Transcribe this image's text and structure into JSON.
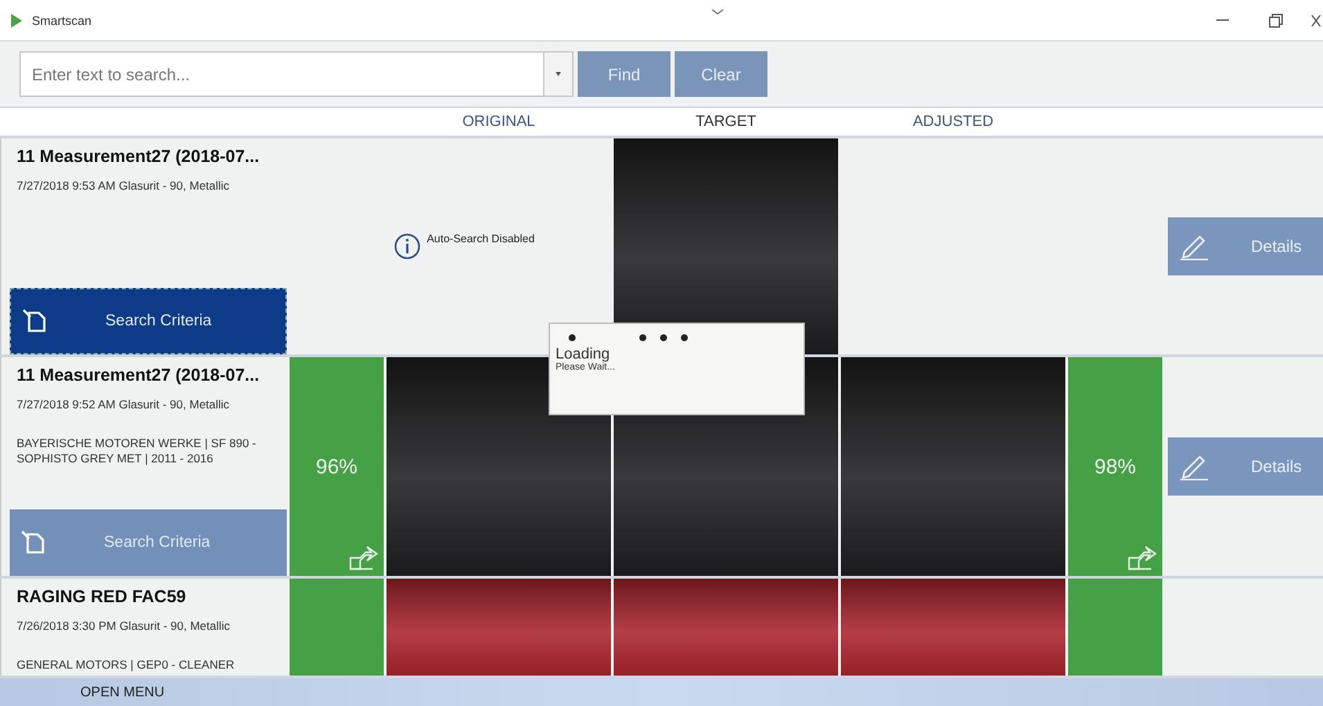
{
  "window": {
    "title": "Smartscan"
  },
  "search": {
    "placeholder": "Enter text to search...",
    "buttons": [
      "Find",
      "Clear"
    ]
  },
  "columns": [
    "ORIGINAL",
    "TARGET",
    "ADJUSTED"
  ],
  "rows": [
    {
      "kind": "unmatched",
      "title": "11 Measurement27 (2018-07...",
      "meta": "7/27/2018 9:53 AM  Glasurit - 90, Metallic",
      "color": "#1e1e20",
      "notice": "Auto-Search Disabled",
      "criteria": {
        "label": "Search Criteria",
        "selected": true
      },
      "details": "Details"
    },
    {
      "kind": "matched",
      "title": "11 Measurement27 (2018-07...",
      "meta": "7/27/2018 9:52 AM  Glasurit - 90, Metallic",
      "vehicle": "BAYERISCHE MOTOREN WERKE  |  SF 890  - SOPHISTO GREY MET  |  2011 - 2016",
      "color": "#1e1e20",
      "original_score": "96%",
      "adjusted_score": "98%",
      "criteria": {
        "label": "Search Criteria",
        "selected": false
      },
      "details": "Details"
    },
    {
      "kind": "matched",
      "title": "RAGING RED FAC59",
      "meta": "7/26/2018 3:30 PM  Glasurit - 90, Metallic",
      "vehicle": "GENERAL MOTORS  |  GEP0  - CLEANER",
      "color": "#a8232d"
    }
  ],
  "loading": {
    "title": "Loading",
    "message": "Please Wait..."
  },
  "footer": {
    "label": "OPEN MENU"
  }
}
